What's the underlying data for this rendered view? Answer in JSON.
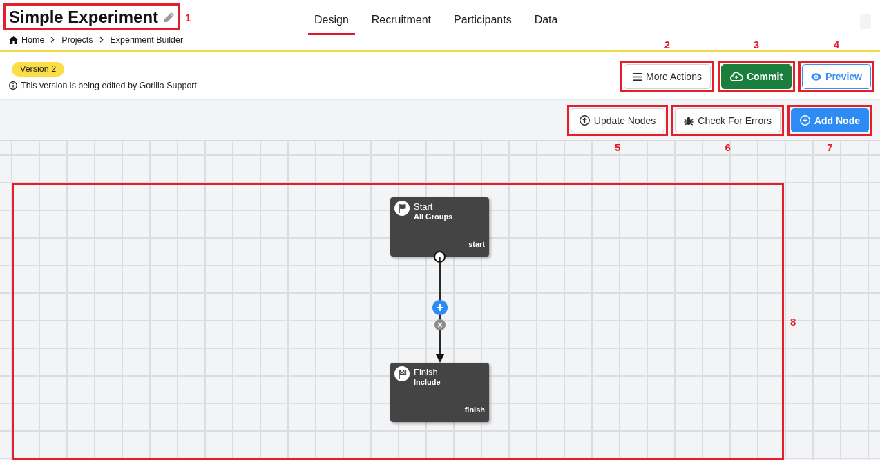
{
  "header": {
    "title": {
      "text": "Simple Experiment",
      "callout": "1"
    },
    "breadcrumb": [
      "Home",
      "Projects",
      "Experiment Builder"
    ]
  },
  "tabs": [
    {
      "label": "Design",
      "selected": true
    },
    {
      "label": "Recruitment",
      "selected": false
    },
    {
      "label": "Participants",
      "selected": false
    },
    {
      "label": "Data",
      "selected": false
    }
  ],
  "version": {
    "badge": "Version 2",
    "notice": "This version is being edited by Gorilla Support"
  },
  "actions": [
    {
      "kind": "menu",
      "label": "More Actions",
      "callout": "2"
    },
    {
      "kind": "commit",
      "label": "Commit",
      "callout": "3"
    },
    {
      "kind": "preview",
      "label": "Preview",
      "callout": "4"
    }
  ],
  "toolbar": [
    {
      "kind": "update",
      "label": "Update Nodes",
      "callout": "5"
    },
    {
      "kind": "check",
      "label": "Check For Errors",
      "callout": "6"
    },
    {
      "kind": "add",
      "label": "Add Node",
      "callout": "7"
    }
  ],
  "canvas": {
    "callout": "8",
    "nodes": [
      {
        "kind": "start",
        "title": "Start",
        "subtitle": "All Groups",
        "tag": "start"
      },
      {
        "kind": "finish",
        "title": "Finish",
        "subtitle": "Include",
        "tag": "finish"
      }
    ]
  }
}
